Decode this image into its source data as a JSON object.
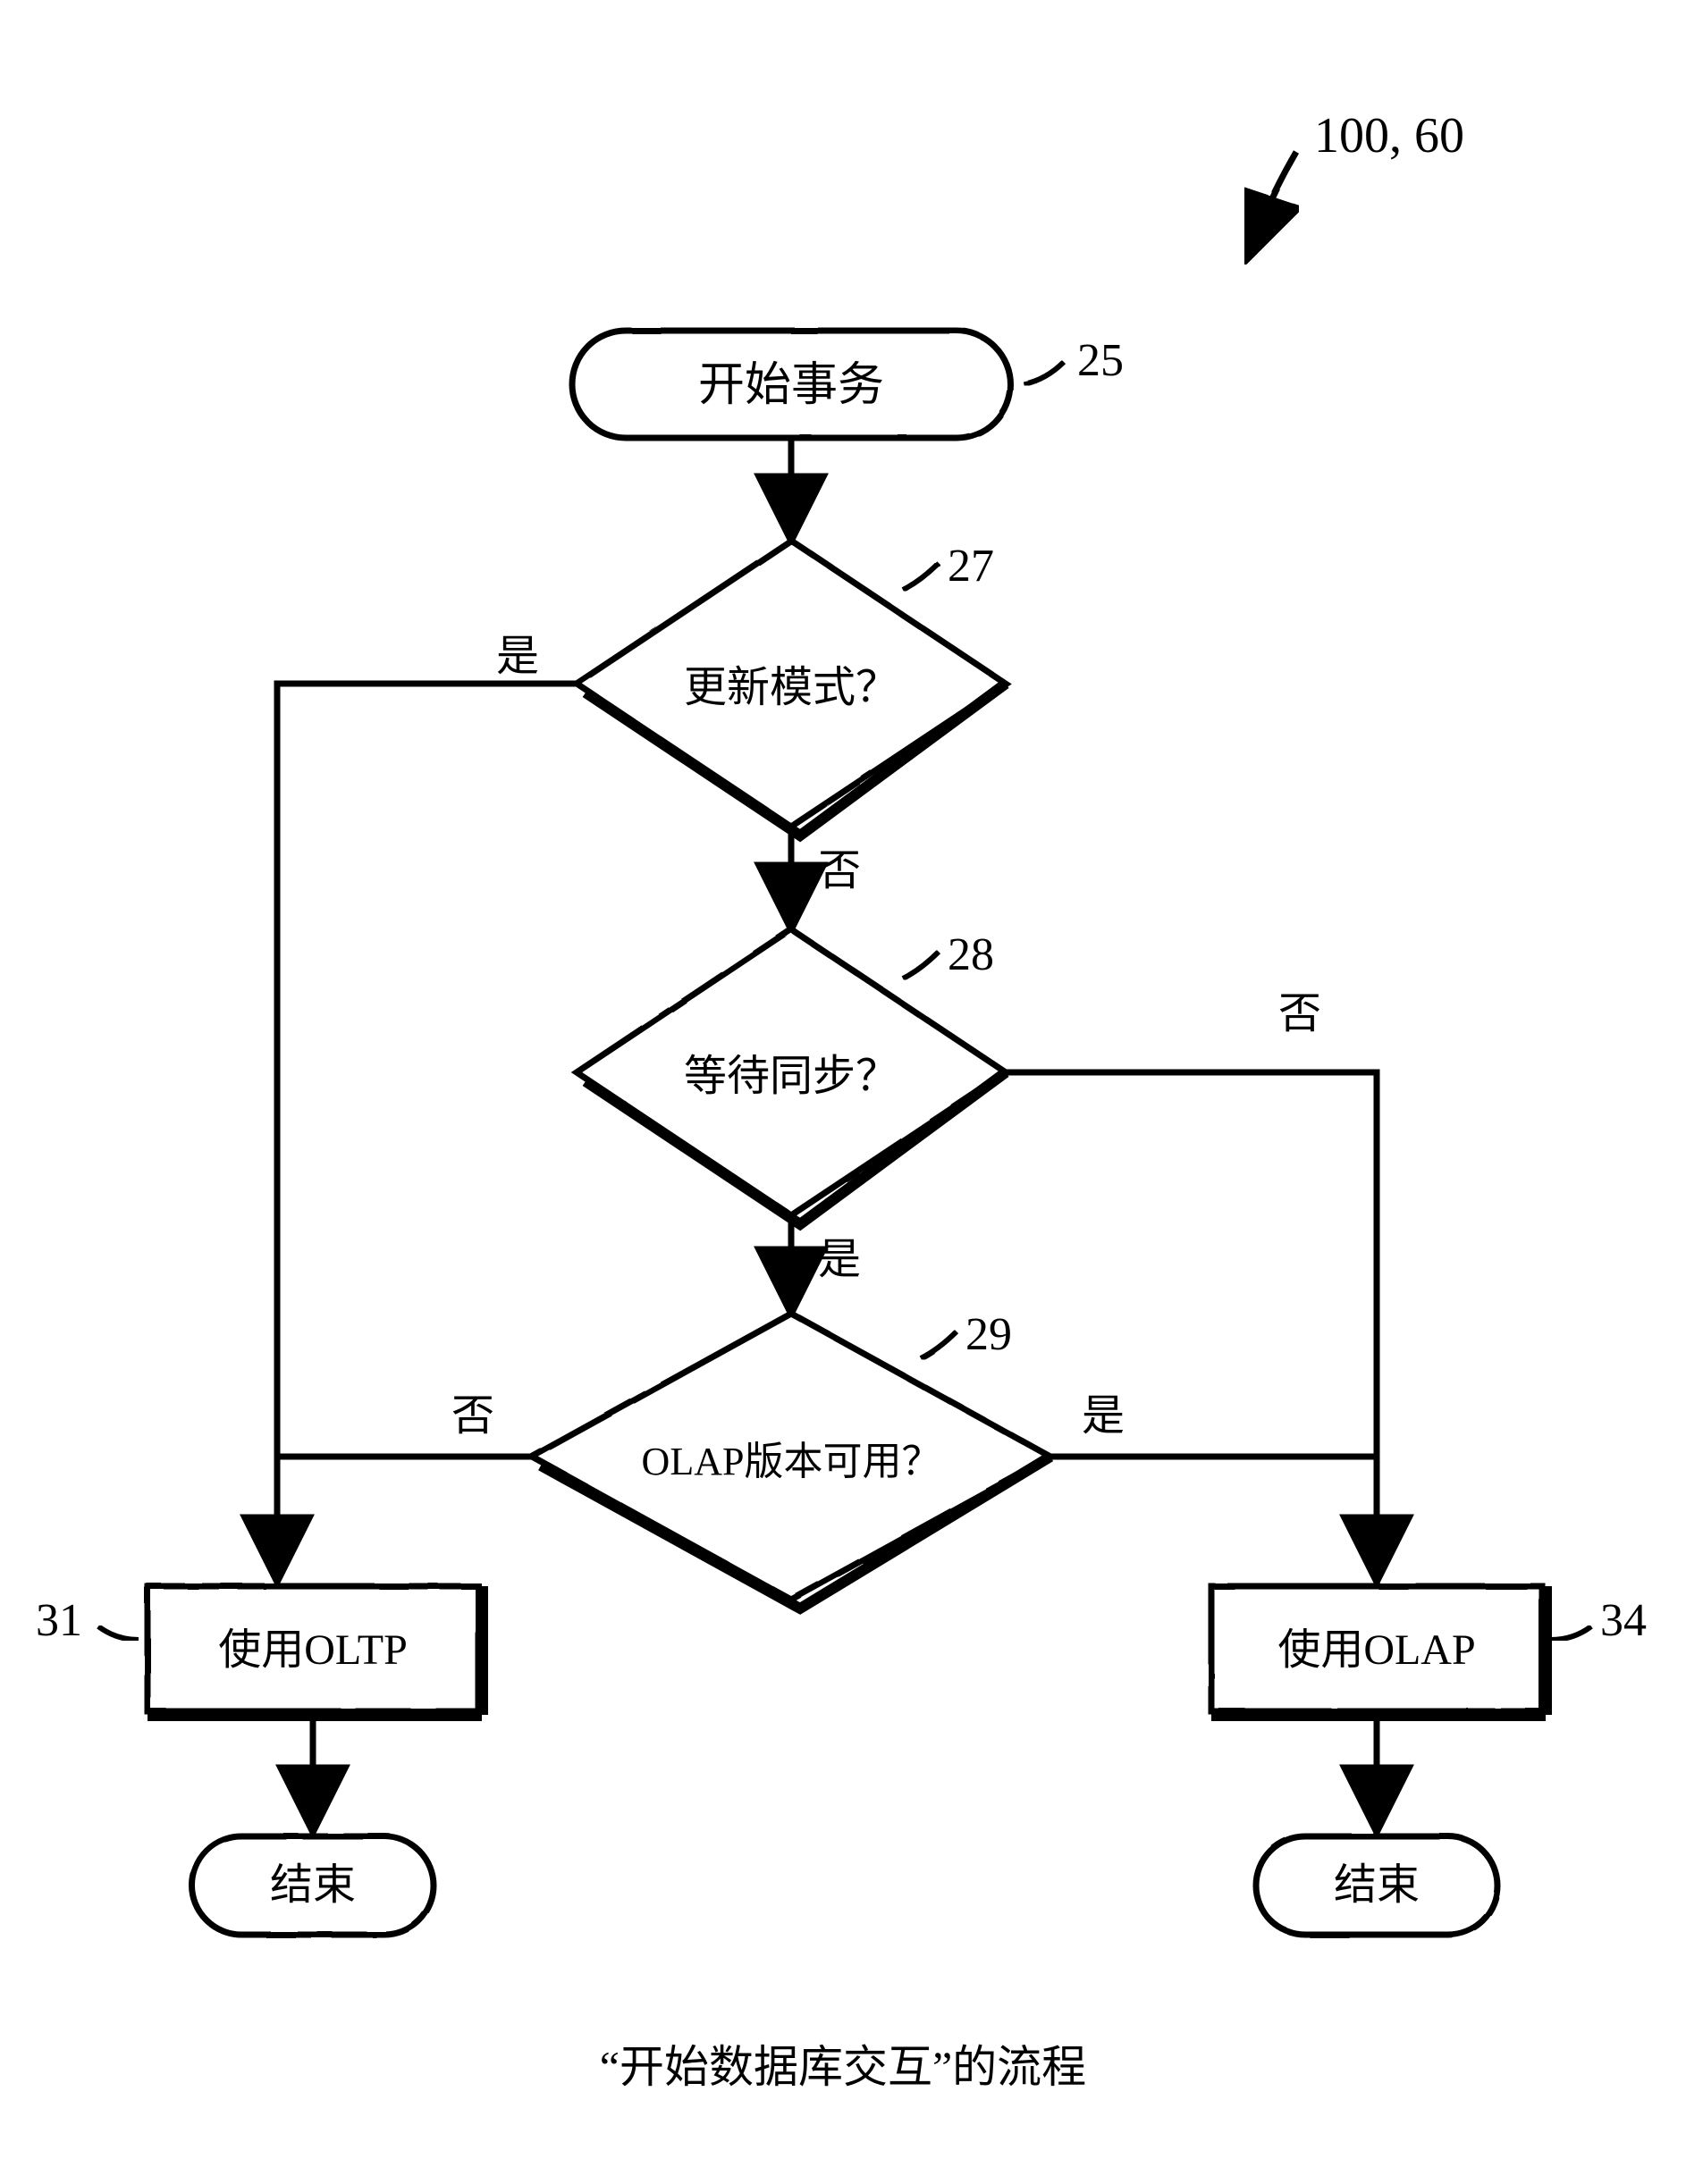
{
  "figure_label_prefix": "100, 60",
  "caption": "“开始数据库交互”的流程",
  "edge_labels": {
    "yes": "是",
    "no": "否"
  },
  "nodes": {
    "start": {
      "ref": "25",
      "label": "开始事务",
      "type": "terminator"
    },
    "q_update": {
      "ref": "27",
      "label": "更新模式？",
      "type": "decision"
    },
    "q_sync": {
      "ref": "28",
      "label": "等待同步？",
      "type": "decision"
    },
    "q_olap": {
      "ref": "29",
      "label": "OLAP版本可用？",
      "type": "decision"
    },
    "oltp": {
      "ref": "31",
      "label": "使用OLTP",
      "type": "process"
    },
    "olap": {
      "ref": "34",
      "label": "使用OLAP",
      "type": "process"
    },
    "end_l": {
      "label": "结束",
      "type": "terminator"
    },
    "end_r": {
      "label": "结束",
      "type": "terminator"
    }
  },
  "chart_data": {
    "type": "flowchart",
    "title": "“开始数据库交互”的流程",
    "nodes": [
      {
        "id": "start",
        "ref": "25",
        "shape": "terminator",
        "text": "开始事务"
      },
      {
        "id": "q_update",
        "ref": "27",
        "shape": "decision",
        "text": "更新模式？"
      },
      {
        "id": "q_sync",
        "ref": "28",
        "shape": "decision",
        "text": "等待同步？"
      },
      {
        "id": "q_olap",
        "ref": "29",
        "shape": "decision",
        "text": "OLAP版本可用？"
      },
      {
        "id": "oltp",
        "ref": "31",
        "shape": "process",
        "text": "使用OLTP"
      },
      {
        "id": "olap",
        "ref": "34",
        "shape": "process",
        "text": "使用OLAP"
      },
      {
        "id": "end_l",
        "shape": "terminator",
        "text": "结束"
      },
      {
        "id": "end_r",
        "shape": "terminator",
        "text": "结束"
      }
    ],
    "edges": [
      {
        "from": "start",
        "to": "q_update"
      },
      {
        "from": "q_update",
        "to": "oltp",
        "label": "是"
      },
      {
        "from": "q_update",
        "to": "q_sync",
        "label": "否"
      },
      {
        "from": "q_sync",
        "to": "q_olap",
        "label": "是"
      },
      {
        "from": "q_sync",
        "to": "olap",
        "label": "否"
      },
      {
        "from": "q_olap",
        "to": "oltp",
        "label": "否"
      },
      {
        "from": "q_olap",
        "to": "olap",
        "label": "是"
      },
      {
        "from": "oltp",
        "to": "end_l"
      },
      {
        "from": "olap",
        "to": "end_r"
      }
    ]
  }
}
